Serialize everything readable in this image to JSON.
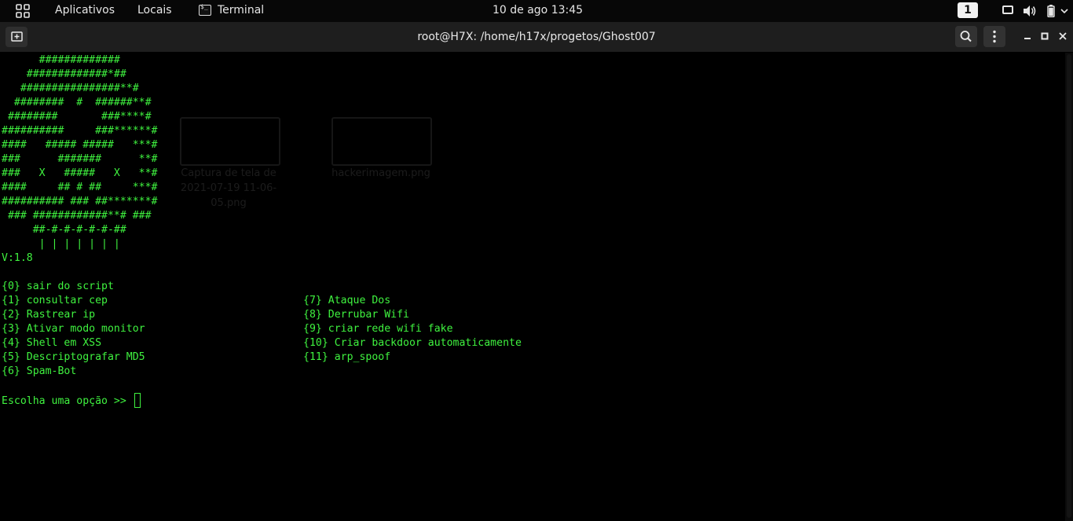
{
  "topbar": {
    "apps_label": "Aplicativos",
    "places_label": "Locais",
    "terminal_label": "Terminal",
    "clock": "10 de ago  13:45",
    "workspace": "1"
  },
  "window": {
    "title": "root@H7X: /home/h17x/progetos/Ghost007"
  },
  "desktop_bleed": {
    "file1_label": "Captura de tela de 2021-07-19 11-06-05.png",
    "file2_label": "hackerimagem.png"
  },
  "terminal": {
    "banner": [
      "      #############",
      "    #############*##",
      "   ################**#",
      "  ########  #  ######**#",
      " ########       ###****#",
      "##########     ###******#",
      "####   ##### #####   ***#",
      "###      #######      **#",
      "###   X   #####   X   **#",
      "####     ## # ##     ***#",
      "########## ### ##*******#",
      " ### ############**# ###",
      "     ##-#-#-#-#-#-##",
      "      | | | | | | |"
    ],
    "version": "V:1.8",
    "options_left": [
      "{0} sair do script",
      "{1} consultar cep",
      "{2} Rastrear ip",
      "{3} Ativar modo monitor",
      "{4} Shell em XSS",
      "{5} Descriptografar MD5",
      "{6} Spam-Bot"
    ],
    "options_right": [
      "{7} Ataque Dos",
      "{8} Derrubar Wifi",
      "{9} criar rede wifi fake",
      "{10} Criar backdoor automaticamente",
      "{11} arp_spoof"
    ],
    "prompt": "Escolha uma opção >> ",
    "text_color": "#3ff23f"
  }
}
